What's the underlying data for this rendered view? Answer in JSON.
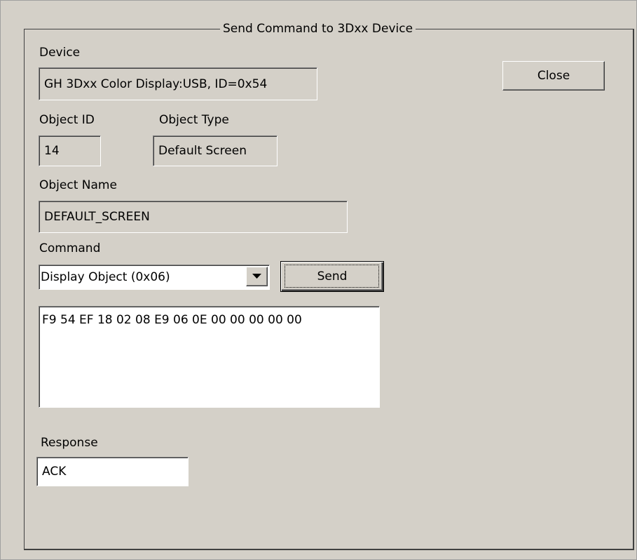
{
  "dialog": {
    "title": "Send Command to 3Dxx Device"
  },
  "device": {
    "label": "Device",
    "value": "GH 3Dxx Color Display:USB, ID=0x54"
  },
  "object": {
    "id_label": "Object ID",
    "id_value": "14",
    "type_label": "Object Type",
    "type_value": "Default Screen",
    "name_label": "Object Name",
    "name_value": "DEFAULT_SCREEN"
  },
  "command": {
    "label": "Command",
    "selected": "Display Object (0x06)",
    "bytes": "F9 54 EF 18 02 08 E9 06 0E 00 00 00 00 00"
  },
  "response": {
    "label": "Response",
    "value": "ACK"
  },
  "buttons": {
    "close": "Close",
    "send": "Send"
  },
  "icons": {
    "combo_arrow": "chevron-down-icon"
  },
  "colors": {
    "dialog_bg": "#d4d0c8",
    "field_bg": "#ffffff"
  }
}
